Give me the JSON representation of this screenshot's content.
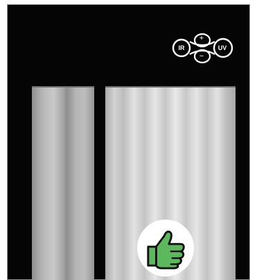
{
  "controls": {
    "ir_label": "IR",
    "uv_label": "UV",
    "plus_label": "+",
    "minus_label": "−"
  },
  "status": {
    "icon": "thumbs-up-icon",
    "color": "#5cb85c"
  },
  "colors": {
    "device_body": "#050505",
    "panel_light": "#d8d8d8"
  }
}
